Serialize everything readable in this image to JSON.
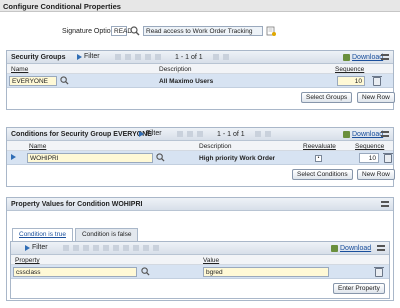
{
  "dialog": {
    "title": "Configure Conditional Properties"
  },
  "signature": {
    "label": "Signature Option:",
    "value": "READ",
    "description": "Read access to Work Order Tracking"
  },
  "security_groups": {
    "title": "Security Groups",
    "filter_label": "Filter",
    "range": "1 - 1 of 1",
    "download_label": "Download",
    "columns": {
      "name": "Name",
      "description": "Description",
      "sequence": "Sequence"
    },
    "rows": [
      {
        "name": "EVERYONE",
        "description": "All Maximo Users",
        "sequence": "10"
      }
    ],
    "buttons": {
      "select": "Select Groups",
      "new_row": "New Row"
    }
  },
  "conditions": {
    "title": "Conditions for Security Group EVERYONE",
    "filter_label": "Filter",
    "range": "1 - 1 of 1",
    "download_label": "Download",
    "columns": {
      "name": "Name",
      "description": "Description",
      "reevaluate": "Reevaluate",
      "sequence": "Sequence"
    },
    "rows": [
      {
        "name": "WOHIPRI",
        "description": "High priority Work Order",
        "reevaluate": true,
        "sequence": "10"
      }
    ],
    "buttons": {
      "select": "Select Conditions",
      "new_row": "New Row"
    }
  },
  "property_values": {
    "title": "Property Values for Condition WOHIPRI",
    "tabs": [
      {
        "label": "Condition is true",
        "active": true
      },
      {
        "label": "Condition is false",
        "active": false
      }
    ],
    "filter_label": "Filter",
    "download_label": "Download",
    "columns": {
      "property": "Property",
      "value": "Value"
    },
    "rows": [
      {
        "property": "cssclass",
        "value": "bgred"
      }
    ],
    "buttons": {
      "enter": "Enter Property"
    }
  },
  "colors": {
    "row_selected": "#d7e3f2",
    "required_field": "#fff9d6",
    "link": "#1a4f9c"
  }
}
